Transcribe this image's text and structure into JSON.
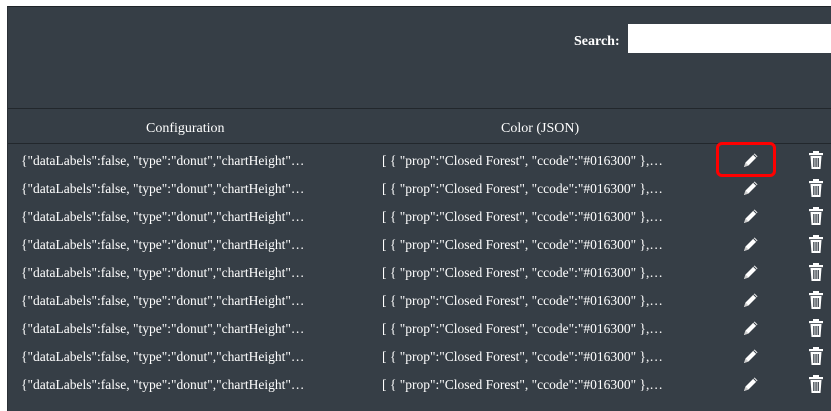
{
  "search": {
    "label": "Search:",
    "value": ""
  },
  "table": {
    "columns": [
      "Configuration",
      "Color (JSON)"
    ],
    "rows": [
      {
        "configuration": "{\"dataLabels\":false, \"type\":\"donut\",\"chartHeight\"…",
        "color_json": "[ { \"prop\":\"Closed Forest\", \"ccode\":\"#016300\" },…"
      },
      {
        "configuration": "{\"dataLabels\":false, \"type\":\"donut\",\"chartHeight\"…",
        "color_json": "[ { \"prop\":\"Closed Forest\", \"ccode\":\"#016300\" },…"
      },
      {
        "configuration": "{\"dataLabels\":false, \"type\":\"donut\",\"chartHeight\"…",
        "color_json": "[ { \"prop\":\"Closed Forest\", \"ccode\":\"#016300\" },…"
      },
      {
        "configuration": "{\"dataLabels\":false, \"type\":\"donut\",\"chartHeight\"…",
        "color_json": "[ { \"prop\":\"Closed Forest\", \"ccode\":\"#016300\" },…"
      },
      {
        "configuration": "{\"dataLabels\":false, \"type\":\"donut\",\"chartHeight\"…",
        "color_json": "[ { \"prop\":\"Closed Forest\", \"ccode\":\"#016300\" },…"
      },
      {
        "configuration": "{\"dataLabels\":false, \"type\":\"donut\",\"chartHeight\"…",
        "color_json": "[ { \"prop\":\"Closed Forest\", \"ccode\":\"#016300\" },…"
      },
      {
        "configuration": "{\"dataLabels\":false, \"type\":\"donut\",\"chartHeight\"…",
        "color_json": "[ { \"prop\":\"Closed Forest\", \"ccode\":\"#016300\" },…"
      },
      {
        "configuration": "{\"dataLabels\":false, \"type\":\"donut\",\"chartHeight\"…",
        "color_json": "[ { \"prop\":\"Closed Forest\", \"ccode\":\"#016300\" },…"
      },
      {
        "configuration": "{\"dataLabels\":false, \"type\":\"donut\",\"chartHeight\"…",
        "color_json": "[ { \"prop\":\"Closed Forest\", \"ccode\":\"#016300\" },…"
      }
    ],
    "row_actions": [
      "pencil-icon",
      "trash-icon"
    ]
  },
  "highlight": {
    "target": "first-row-edit-button",
    "color": "#ff0000"
  },
  "colors": {
    "background": "#363e46",
    "text": "#ffffff",
    "divider": "#22272c"
  }
}
